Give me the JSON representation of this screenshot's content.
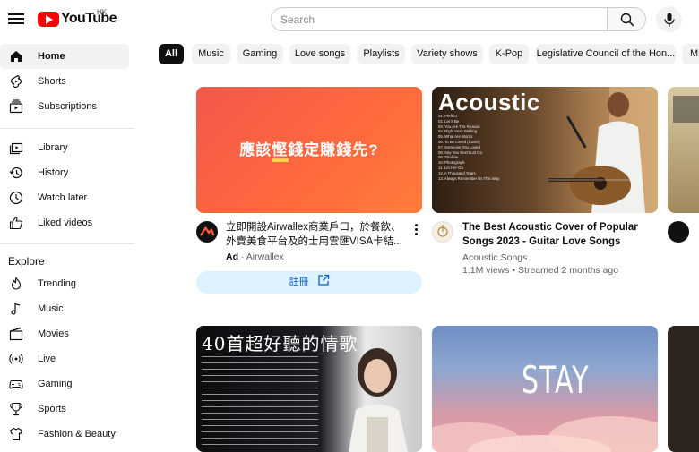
{
  "header": {
    "logo_text": "YouTube",
    "region": "HK",
    "search_placeholder": "Search"
  },
  "sidebar": {
    "main": [
      {
        "label": "Home",
        "icon": "home-icon",
        "active": true
      },
      {
        "label": "Shorts",
        "icon": "shorts-icon"
      },
      {
        "label": "Subscriptions",
        "icon": "subscriptions-icon"
      }
    ],
    "library": [
      {
        "label": "Library",
        "icon": "library-icon"
      },
      {
        "label": "History",
        "icon": "history-icon"
      },
      {
        "label": "Watch later",
        "icon": "watch-later-icon"
      },
      {
        "label": "Liked videos",
        "icon": "liked-icon"
      }
    ],
    "explore_heading": "Explore",
    "explore": [
      {
        "label": "Trending",
        "icon": "trending-icon"
      },
      {
        "label": "Music",
        "icon": "music-icon"
      },
      {
        "label": "Movies",
        "icon": "movies-icon"
      },
      {
        "label": "Live",
        "icon": "live-icon"
      },
      {
        "label": "Gaming",
        "icon": "gaming-icon"
      },
      {
        "label": "Sports",
        "icon": "sports-icon"
      },
      {
        "label": "Fashion & Beauty",
        "icon": "fashion-icon"
      }
    ]
  },
  "chips": [
    "All",
    "Music",
    "Gaming",
    "Love songs",
    "Playlists",
    "Variety shows",
    "K-Pop",
    "Legislative Council of the Hon...",
    "M"
  ],
  "ad_card": {
    "thumb_text": "應該慳錢定賺錢先?",
    "title": "立即開設Airwallex商業戶口，於餐飲、外賣美食平台及的士用雲匯VISA卡結...",
    "ad_badge": "Ad",
    "advertiser": "Airwallex",
    "cta_label": "註冊",
    "accent": "#ff5a3c"
  },
  "video_card": {
    "thumb_text": "Acoustic",
    "title": "The Best Acoustic Cover of Popular Songs 2023 - Guitar Love Songs Cover...",
    "channel": "Acoustic Songs",
    "stats": "1.1M views • Streamed 2 months ago",
    "tracklist": [
      "01. Perfect",
      "02. Let It Be",
      "03. You Are The Reason",
      "04. Right Here Waiting",
      "05. What Are Words",
      "06. To Be Loved (Cover)",
      "07. Someone You Loved",
      "08. Say You Won't Let Go",
      "09. Shallow",
      "10. Photograph",
      "11. Let Her Go",
      "12. A Thousand Years",
      "13. Always Remember Us This Way"
    ]
  },
  "bottom_cards": [
    {
      "thumb_text": "40首超好聽的情歌"
    },
    {
      "thumb_text": "STAY"
    }
  ]
}
